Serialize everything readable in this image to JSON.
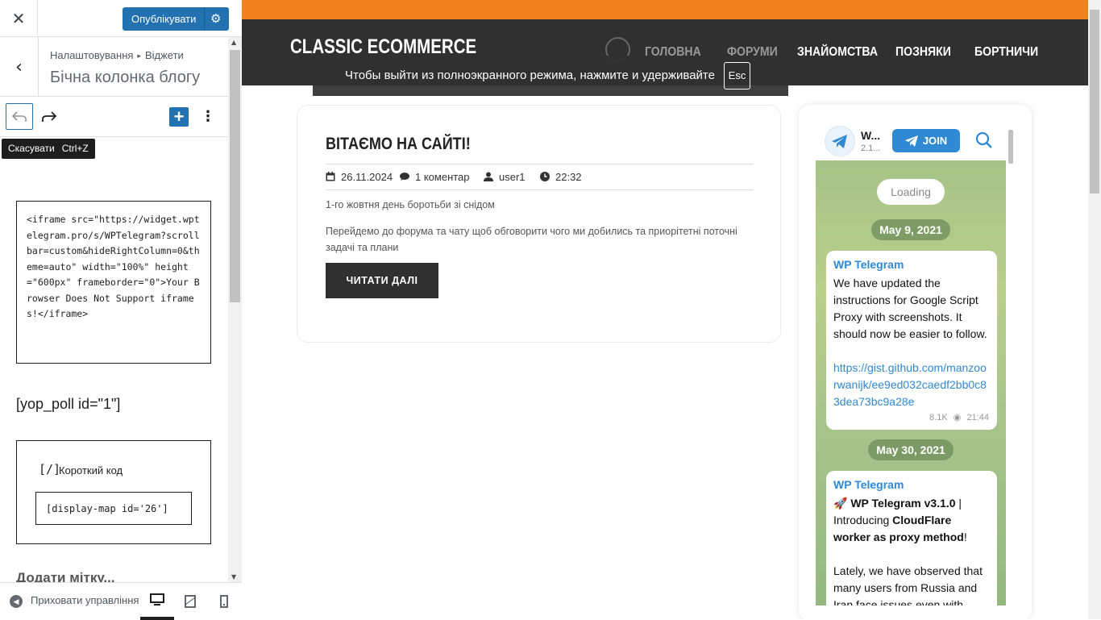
{
  "panel": {
    "close_icon": "close-icon",
    "publish_label": "Опублікувати",
    "breadcrumb": [
      "Налаштовування",
      "Віджети"
    ],
    "breadcrumb_separator": "▸",
    "section_title": "Бічна колонка блогу",
    "tooltip_label": "Скасувати",
    "tooltip_shortcut": "Ctrl+Z",
    "code_block_text": "<iframe src=\"https://widget.wptelegram.pro/s/WPTelegram?scrollbar=custom&hideRightColumn=0&theme=auto\" width=\"100%\" height=\"600px\" frameborder=\"0\">Your Browser Does Not Support iframes!</iframe>",
    "shortcode_text": "[yop_poll id=\"1\"]",
    "shortcode_block": {
      "icon": "[/]",
      "label": "Короткий код",
      "value": "[display-map id='26']"
    },
    "add_tag_label": "Додати мітку...",
    "footer": {
      "hide_controls_label": "Приховати управління"
    }
  },
  "preview": {
    "site_title": "CLASSIC ECOMMERCE",
    "nav": [
      "ГОЛОВНА",
      "ФОРУМИ",
      "ЗНАЙОМСТВА",
      "ПОЗНЯКИ",
      "БОРТНИЧИ"
    ],
    "fullscreen_notice": "Чтобы выйти из полноэкранного режима, нажмите и удерживайте",
    "fullscreen_key": "Esc",
    "post": {
      "title": "ВІТАЄМО НА САЙТІ!",
      "date": "26.11.2024",
      "comments": "1 коментар",
      "author": "user1",
      "time": "22:32",
      "line1": "1-го жовтня день боротьби зі снідом",
      "line2": "Перейдемо до форума та чату щоб обговорити чого ми добились та приорітетні поточні задачі та плани",
      "read_more": "ЧИТАТИ ДАЛІ"
    },
    "telegram": {
      "channel_name": "W...",
      "channel_sub": "2.1...",
      "join_label": "JOIN",
      "loading": "Loading",
      "date1": "May 9, 2021",
      "msg1": {
        "author": "WP Telegram",
        "text": "We have updated the instructions for Google Script Proxy with screenshots. It should now be easier to follow.",
        "link": "https://gist.github.com/manzoorwanijk/ee9ed032caedf2bb0c83dea73bc9a28e",
        "views": "8.1K",
        "time": "21:44"
      },
      "date2": "May 30, 2021",
      "msg2": {
        "author": "WP Telegram",
        "emoji": "🚀",
        "title": "WP Telegram v3.1.0",
        "after_title": " | Introducing ",
        "bold2": "CloudFlare worker as proxy method",
        "after_bold2": "!",
        "para2": "Lately, we have observed that many users from Russia and Iran face issues even with"
      }
    }
  },
  "colors": {
    "accent_blue": "#2271b1",
    "topbar_orange": "#f0821e",
    "navbar_dark": "#303030",
    "telegram_blue": "#2f89d3"
  }
}
